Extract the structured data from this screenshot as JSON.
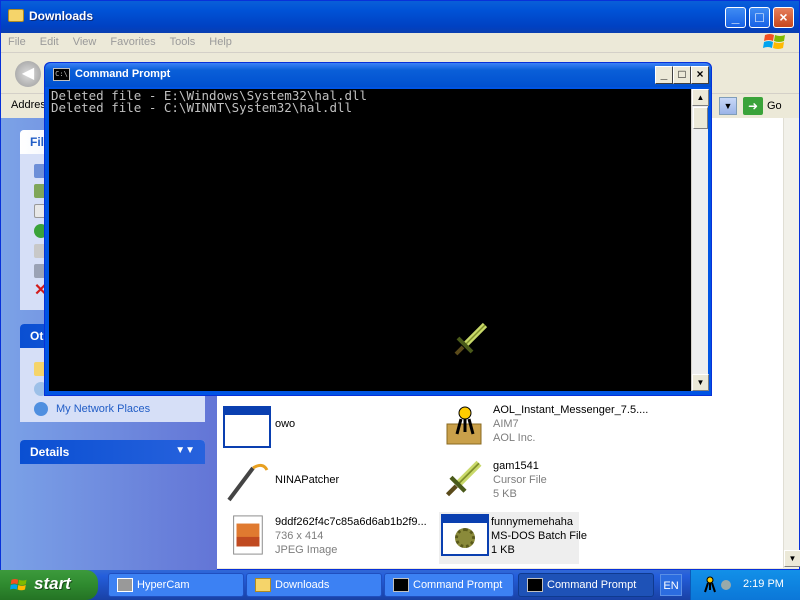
{
  "explorer": {
    "title": "Downloads",
    "menu": [
      "File",
      "Edit",
      "View",
      "Favorites",
      "Tools",
      "Help"
    ],
    "address_label": "Address",
    "go_label": "Go",
    "left_panels": {
      "file_tasks_header": "Fil",
      "other_places_header": "Ot",
      "network_places_label": "My Network Places",
      "details_header": "Details"
    },
    "files": [
      {
        "name": "owo",
        "line2": "",
        "line3": "",
        "icon": "window-icon"
      },
      {
        "name": "AOL_Instant_Messenger_7.5....",
        "line2": "AIM7",
        "line3": "AOL Inc.",
        "icon": "aim-setup-icon"
      },
      {
        "name": "NINAPatcher",
        "line2": "",
        "line3": "",
        "icon": "wand-icon"
      },
      {
        "name": "gam1541",
        "line2": "Cursor File",
        "line3": "5 KB",
        "icon": "sword-icon"
      },
      {
        "name": "9ddf262f4c7c85a6d6ab1b2f9...",
        "line2": "736 x 414",
        "line3": "JPEG Image",
        "icon": "image-icon"
      },
      {
        "name": "funnymemehaha",
        "line2": "MS-DOS Batch File",
        "line3": "1 KB",
        "icon": "batch-gear-icon"
      }
    ]
  },
  "cmd": {
    "title": "Command Prompt",
    "lines": [
      "Deleted file - E:\\Windows\\System32\\hal.dll",
      "Deleted file - C:\\WINNT\\System32\\hal.dll"
    ]
  },
  "taskbar": {
    "start_label": "start",
    "buttons": [
      {
        "label": "HyperCam",
        "icon": "hypercam-icon",
        "active": false
      },
      {
        "label": "Downloads",
        "icon": "folder-icon",
        "active": false
      },
      {
        "label": "Command Prompt",
        "icon": "cmd-icon",
        "active": false
      },
      {
        "label": "Command Prompt",
        "icon": "cmd-icon",
        "active": true
      }
    ],
    "lang": "EN",
    "clock": "2:19 PM"
  },
  "colors": {
    "xp_blue": "#0054e3",
    "start_green": "#2f8a2f",
    "link_blue": "#215dc6"
  }
}
